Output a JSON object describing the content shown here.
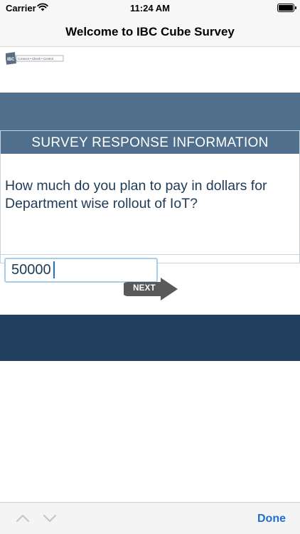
{
  "status_bar": {
    "carrier": "Carrier",
    "time": "11:24 AM",
    "wifi_icon": "wifi-icon",
    "battery_icon": "battery-icon"
  },
  "nav": {
    "title": "Welcome to IBC Cube Survey"
  },
  "logo": {
    "mark": "IBC",
    "tagline": "Connect • Check • Control"
  },
  "survey": {
    "header": "SURVEY RESPONSE INFORMATION",
    "question": "How much do you plan to pay in dollars for Department wise rollout of IoT?",
    "answer_value": "50000"
  },
  "next_button": {
    "label": "NEXT",
    "icon": "arrow-right-icon"
  },
  "toolbar": {
    "prev_icon": "chevron-up-icon",
    "next_icon": "chevron-down-icon",
    "done_label": "Done"
  },
  "colors": {
    "band_top": "#4f6f8d",
    "band_bottom": "#213f5f",
    "question_text": "#1e3a57",
    "input_border": "#a8cde8",
    "done_blue": "#1f6fcf",
    "next_gray": "#595959"
  }
}
